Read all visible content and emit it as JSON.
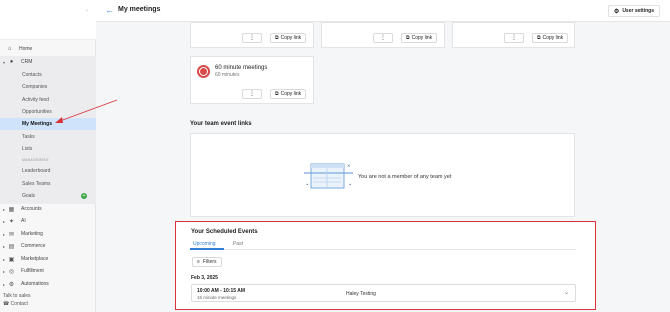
{
  "header": {
    "page_title": "My meetings",
    "user_settings_label": "User settings"
  },
  "sidebar": {
    "home": "Home",
    "crm": "CRM",
    "crm_items": [
      "Contacts",
      "Companies",
      "Activity feed",
      "Opportunities",
      "My Meetings",
      "Tasks",
      "Lists"
    ],
    "management_label": "MANAGEMENT",
    "management_items": [
      "Leaderboard",
      "Sales Teams",
      "Goals"
    ],
    "sections": [
      "Accounts",
      "AI",
      "Marketing",
      "Commerce",
      "Marketplace",
      "Fulfillment",
      "Automations"
    ],
    "footer_talk": "Talk to sales",
    "footer_contact": "Contact"
  },
  "meeting_cards": {
    "copy_label": "Copy link",
    "kebab_label": "⋮",
    "bottom_card_title": "60 minute meetings",
    "bottom_card_subtitle": "60 minutes"
  },
  "team": {
    "title": "Your team event links",
    "empty_text": "You are not a member of any team yet"
  },
  "scheduled": {
    "title": "Your Scheduled Events",
    "tabs": [
      "Upcoming",
      "Past"
    ],
    "filters_label": "Filters",
    "date": "Feb 3, 2025",
    "event": {
      "time": "10:00 AM - 10:15 AM",
      "type": "15 minute meetings",
      "name": "Haley Testing"
    }
  },
  "colors": {
    "accent": "#2f7fd6",
    "active_nav": "#cfe4fb",
    "highlight_border": "#d9323b",
    "clock": "#d94a4a"
  }
}
